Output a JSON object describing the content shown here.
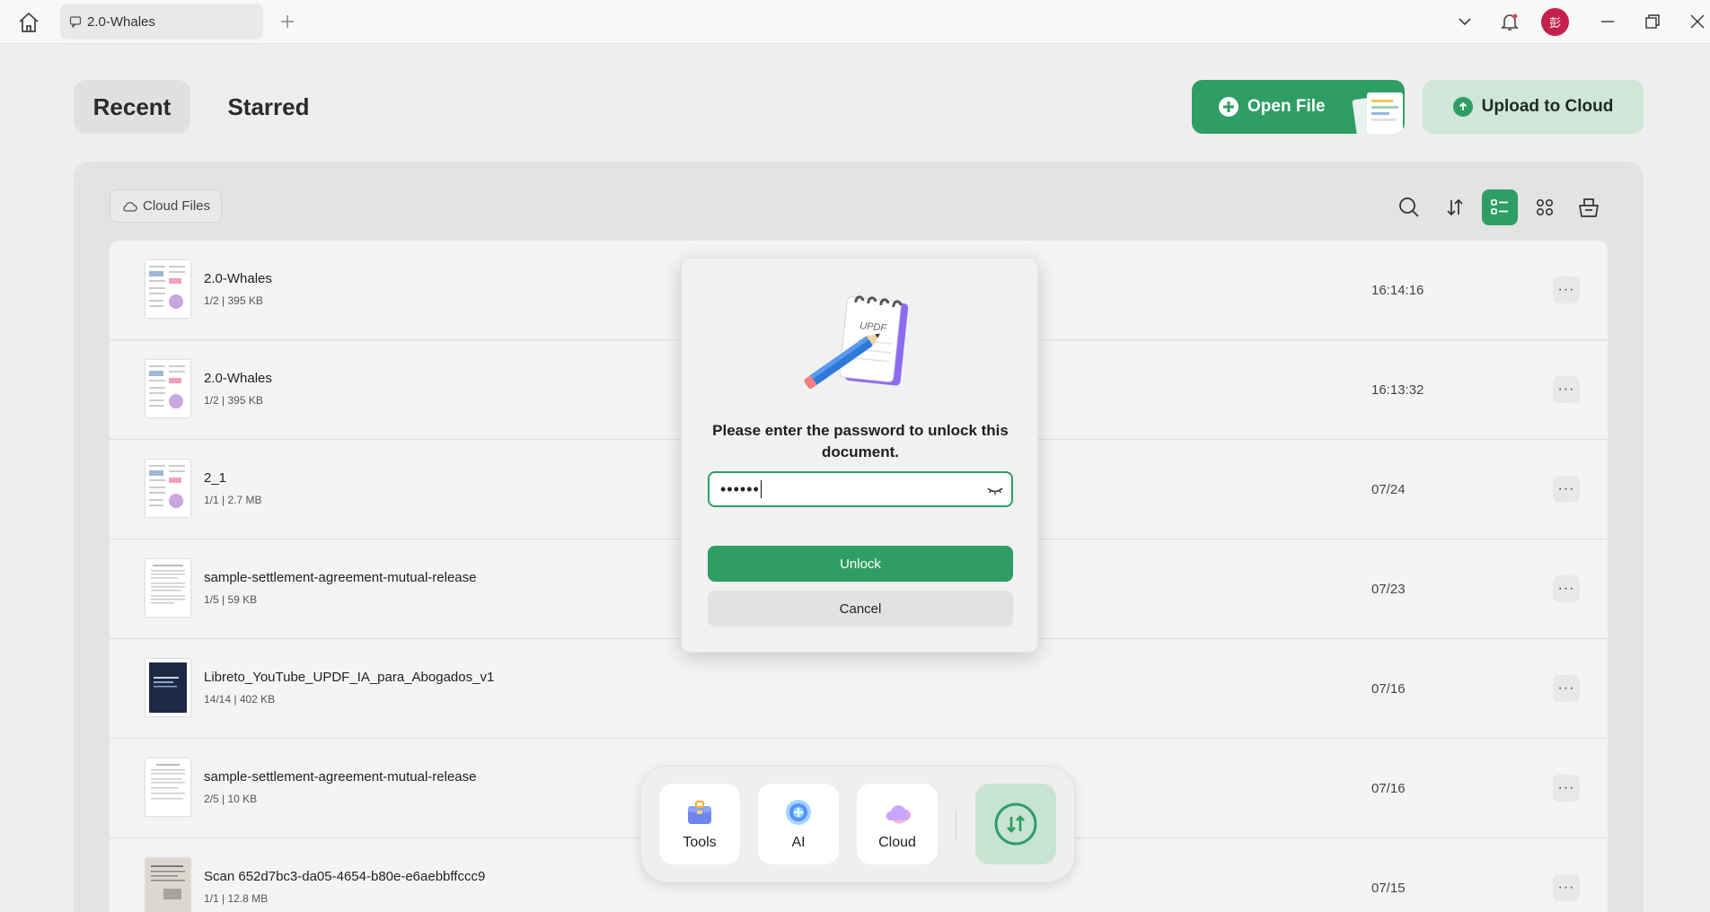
{
  "titlebar": {
    "tab_title": "2.0-Whales",
    "avatar_initial": "彭"
  },
  "header": {
    "tab_recent": "Recent",
    "tab_starred": "Starred",
    "open_file": "Open File",
    "upload_to_cloud": "Upload to Cloud"
  },
  "toolbar": {
    "cloud_files": "Cloud Files",
    "view_mode": "list"
  },
  "files": [
    {
      "name": "2.0-Whales",
      "meta": "1/2 | 395 KB",
      "date": "16:14:16"
    },
    {
      "name": "2.0-Whales",
      "meta": "1/2 | 395 KB",
      "date": "16:13:32"
    },
    {
      "name": "2_1",
      "meta": "1/1 | 2.7 MB",
      "date": "07/24"
    },
    {
      "name": "sample-settlement-agreement-mutual-release",
      "meta": "1/5 | 59 KB",
      "date": "07/23"
    },
    {
      "name": "Libreto_YouTube_UPDF_IA_para_Abogados_v1",
      "meta": "14/14 | 402 KB",
      "date": "07/16"
    },
    {
      "name": "sample-settlement-agreement-mutual-release",
      "meta": "2/5 | 10 KB",
      "date": "07/16"
    },
    {
      "name": "Scan 652d7bc3-da05-4654-b80e-e6aebbffccc9",
      "meta": "1/1 | 12.8 MB",
      "date": "07/15"
    }
  ],
  "dock": {
    "tools": "Tools",
    "ai": "AI",
    "cloud": "Cloud"
  },
  "dialog": {
    "illustration_text": "UPDF",
    "title": "Please enter the password to unlock this document.",
    "password_masked": "••••••",
    "unlock": "Unlock",
    "cancel": "Cancel"
  },
  "colors": {
    "accent": "#2e9e64",
    "accent_light": "#cfe6d8",
    "avatar": "#c4214f"
  }
}
